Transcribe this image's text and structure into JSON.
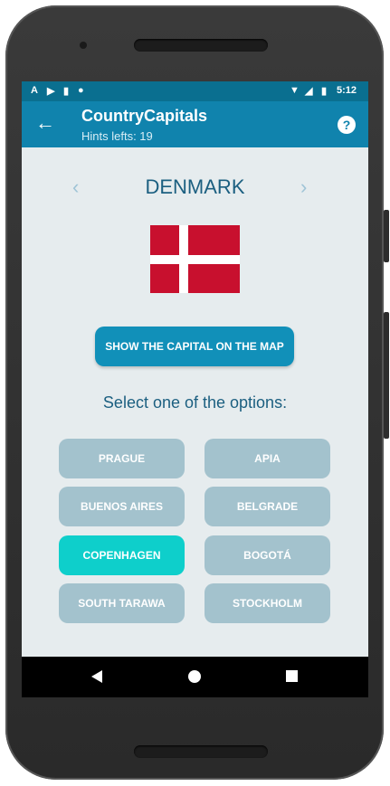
{
  "status_bar": {
    "time": "5:12",
    "left_icons": [
      "a-icon",
      "youtube-icon",
      "sd-card-icon",
      "circle-icon"
    ],
    "right_icons": [
      "wifi-icon",
      "signal-icon",
      "battery-icon"
    ]
  },
  "app_bar": {
    "title": "CountryCapitals",
    "subtitle": "Hints lefts: 19",
    "back_icon": "arrow-left-icon",
    "help_label": "?"
  },
  "quiz": {
    "country": "DENMARK",
    "prev_label": "‹",
    "next_label": "›",
    "flag": {
      "name": "denmark-flag",
      "field_color": "#c8102e",
      "cross_color": "#ffffff"
    },
    "map_button": "SHOW THE CAPITAL ON THE MAP",
    "prompt": "Select one of the options:",
    "options": [
      "PRAGUE",
      "APIA",
      "BUENOS AIRES",
      "BELGRADE",
      "COPENHAGEN",
      "BOGOTÁ",
      "SOUTH TARAWA",
      "STOCKHOLM"
    ],
    "selected_option": "COPENHAGEN"
  },
  "colors": {
    "status_bar": "#0a6f90",
    "app_bar": "#1083ad",
    "option_default": "#a3c2cd",
    "option_selected": "#0ecfcb",
    "button": "#1190b9"
  }
}
